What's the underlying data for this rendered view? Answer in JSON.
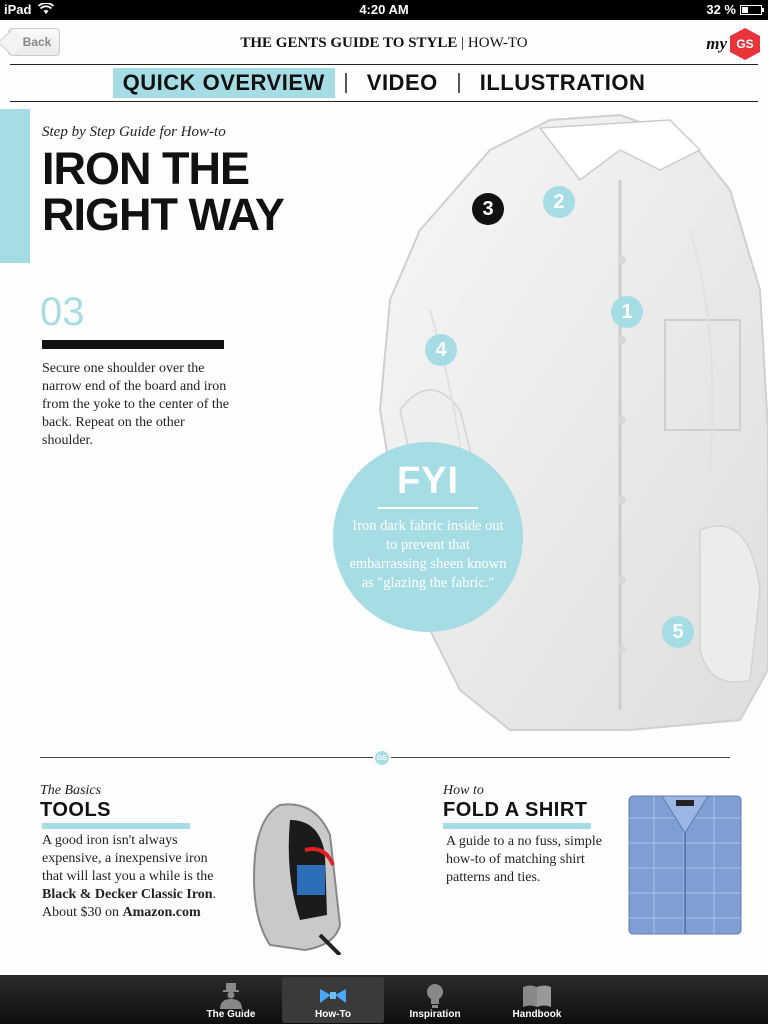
{
  "status": {
    "device": "iPad",
    "time": "4:20 AM",
    "battery": "32 %"
  },
  "nav": {
    "back": "Back",
    "title_brand": "THE GENTS GUIDE TO STYLE",
    "title_section": "HOW-TO",
    "my": "my",
    "logo": "GS"
  },
  "tabs": [
    {
      "label": "QUICK OVERVIEW",
      "active": true
    },
    {
      "label": "VIDEO",
      "active": false
    },
    {
      "label": "ILLUSTRATION",
      "active": false
    }
  ],
  "article": {
    "kicker": "Step by Step Guide for How-to",
    "headline_1": "IRON THE",
    "headline_2": "RIGHT WAY",
    "step_number": "03",
    "step_text": "Secure one shoulder over the narrow end of the board and iron from the yoke to the center of the back. Repeat on the other shoulder."
  },
  "markers": [
    "1",
    "2",
    "3",
    "4",
    "5"
  ],
  "fyi": {
    "title": "FYI",
    "text": "Iron dark fabric inside out to prevent that embarrassing sheen known as \"glazing the fabric.\""
  },
  "divider_logo": "GS",
  "tools": {
    "kicker": "The Basics",
    "title": "TOOLS",
    "text_1": "A good iron isn't always expensive, a inexpensive iron that will last you a while is the ",
    "text_bold_1": "Black & Decker Classic Iron",
    "text_2": ". About $30 on ",
    "text_bold_2": "Amazon.com"
  },
  "fold": {
    "kicker": "How to",
    "title": "FOLD A SHIRT",
    "text": "A guide to a no fuss, simple how-to of matching shirt patterns and ties."
  },
  "tabbar": [
    {
      "label": "The Guide",
      "icon": "gentleman-icon",
      "active": false
    },
    {
      "label": "How-To",
      "icon": "bowtie-icon",
      "active": true
    },
    {
      "label": "Inspiration",
      "icon": "lightbulb-icon",
      "active": false
    },
    {
      "label": "Handbook",
      "icon": "book-icon",
      "active": false
    }
  ],
  "colors": {
    "accent": "#a6dde4",
    "logo_red": "#e8343b"
  }
}
